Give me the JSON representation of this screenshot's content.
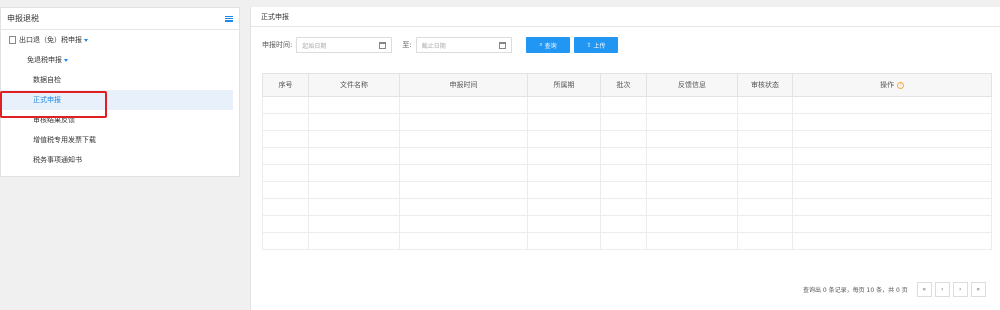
{
  "sidebar": {
    "title": "申报退税",
    "l1_label": "出口退（免）税申报",
    "l2_label": "免退税申报",
    "items": [
      {
        "label": "数据自检"
      },
      {
        "label": "正式申报"
      },
      {
        "label": "审核结果反馈"
      },
      {
        "label": "增值税专用发票下载"
      },
      {
        "label": "税务事项通知书"
      }
    ]
  },
  "main": {
    "title": "正式申报",
    "filter": {
      "time_label": "申报时间:",
      "start_placeholder": "起始日期",
      "to_label": "至:",
      "end_placeholder": "截止日期",
      "query_label": "查询",
      "upload_label": "上传"
    },
    "table": {
      "headers": [
        "序号",
        "文件名称",
        "申报时间",
        "所属期",
        "批次",
        "反馈信息",
        "审核状态",
        "操作"
      ],
      "row_count": 9
    },
    "pager": {
      "summary": "查询出 0 条记录，每页 10 条，共 0 页",
      "first": "«",
      "prev": "‹",
      "next": "›",
      "last": "»"
    }
  },
  "colors": {
    "accent": "#2196f3",
    "highlight_box": "#e02020"
  }
}
